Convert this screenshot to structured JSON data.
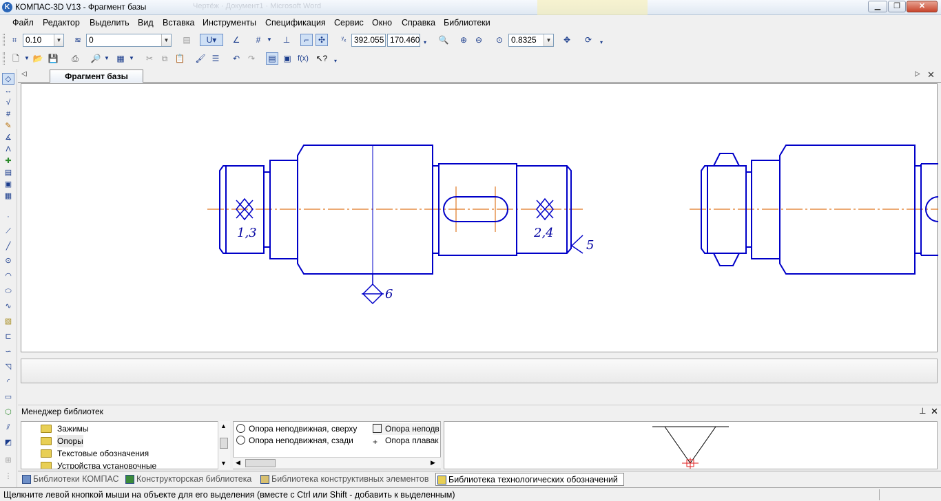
{
  "window": {
    "title": "КОМПАС-3D V13 - Фрагмент базы",
    "app_icon_letter": "K",
    "ghost_text": "Чертёж · Документ1 · Microsoft Word"
  },
  "menu": [
    "Файл",
    "Редактор",
    "Выделить",
    "Вид",
    "Вставка",
    "Инструменты",
    "Спецификация",
    "Сервис",
    "Окно",
    "Справка",
    "Библиотеки"
  ],
  "toolbar": {
    "step_value": "0.10",
    "layer_value": "0",
    "coord_x": "392.055",
    "coord_y": "170.460",
    "zoom_value": "0.8325"
  },
  "document_tab": {
    "label": "Фрагмент базы"
  },
  "drawing": {
    "labels": {
      "left_base": "1,3",
      "right_base": "2,4",
      "right_end": "5",
      "bottom": "6"
    },
    "colors": {
      "outline": "#0000c8",
      "axis": "#e07820",
      "text": "#0000a0"
    }
  },
  "library_manager": {
    "title": "Менеджер библиотек",
    "tree": [
      "Зажимы",
      "Опоры",
      "Текстовые обозначения",
      "Устройства установочные"
    ],
    "selected_tree_index": 1,
    "list": [
      {
        "label": "Опора неподвижная, сверху",
        "icon": "circle-dot-icon"
      },
      {
        "label": "Опора неподвижная, сзади",
        "icon": "circle-icon"
      },
      {
        "label": "Опора неподв",
        "icon": "triangle-icon"
      },
      {
        "label": "Опора плавак",
        "icon": "crosshair-icon"
      }
    ],
    "tabs": [
      "Библиотеки КОМПАС",
      "Конструкторская библиотека",
      "Библиотека конструктивных элементов",
      "Библиотека технологических обозначений"
    ],
    "active_tab_index": 3
  },
  "status": {
    "text": "Щелкните левой кнопкой мыши на объекте для его выделения (вместе с Ctrl или Shift - добавить к выделенным)"
  }
}
